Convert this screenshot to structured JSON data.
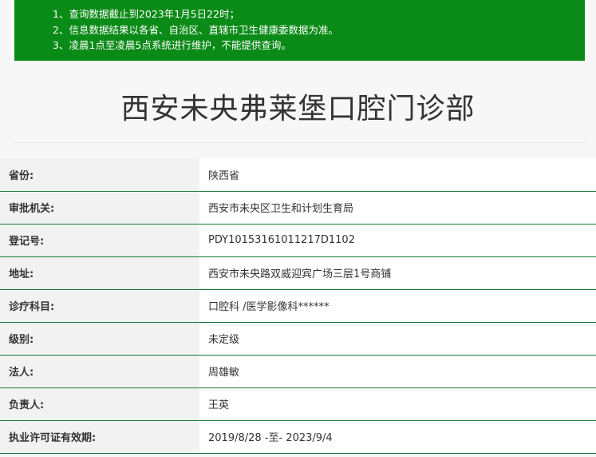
{
  "notice": {
    "lines": [
      "1、查询数据截止到2023年1月5日22时；",
      "2、信息数据结果以各省、自治区、直辖市卫生健康委数据为准。",
      "3、凌晨1点至凌晨5点系统进行维护，不能提供查询。"
    ]
  },
  "page_title": "西安未央弗莱堡口腔门诊部",
  "fields": [
    {
      "label": "省份:",
      "value": "陕西省"
    },
    {
      "label": "审批机关:",
      "value": "西安市未央区卫生和计划生育局"
    },
    {
      "label": "登记号:",
      "value": "PDY10153161011217D1102"
    },
    {
      "label": "地址:",
      "value": "西安市未央路双威迎宾广场三层1号商铺"
    },
    {
      "label": "诊疗科目:",
      "value": "口腔科 /医学影像科******"
    },
    {
      "label": "级别:",
      "value": "未定级"
    },
    {
      "label": "法人:",
      "value": "周雄敏"
    },
    {
      "label": "负责人:",
      "value": "王英"
    },
    {
      "label": "执业许可证有效期:",
      "value": "2019/8/28 -至- 2023/9/4"
    }
  ],
  "colors": {
    "notice_bg": "#0a8a17",
    "row_border": "#137b3a"
  }
}
